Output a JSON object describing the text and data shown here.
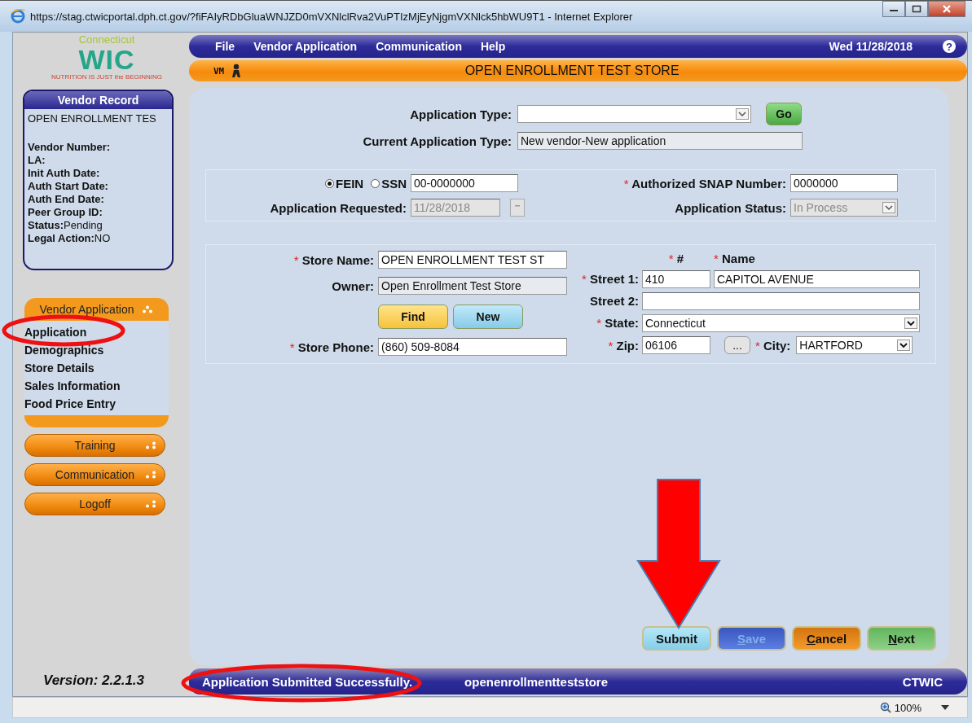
{
  "window": {
    "title": "https://stag.ctwicportal.dph.ct.gov/?fiFAIyRDbGluaWNJZD0mVXNlclRva2VuPTIzMjEyNjgmVXNlck5hbWU9T1 - Internet Explorer",
    "zoom": "100%"
  },
  "logo": {
    "state": "Connecticut",
    "mark": "WIC",
    "tagline": "NUTRITION IS JUST the BEGINNING"
  },
  "menu": [
    "File",
    "Vendor Application",
    "Communication",
    "Help"
  ],
  "date": "Wed 11/28/2018",
  "help": "?",
  "banner": {
    "code": "VM",
    "title": "OPEN ENROLLMENT TEST STORE"
  },
  "vendor_record": {
    "title": "Vendor Record",
    "name": "OPEN ENROLLMENT TES",
    "fields": [
      {
        "label": "Vendor Number:"
      },
      {
        "label": "LA:"
      },
      {
        "label": "Init Auth Date:"
      },
      {
        "label": "Auth Start Date:"
      },
      {
        "label": "Auth End Date:"
      },
      {
        "label": "Peer Group ID:"
      },
      {
        "label": "Status:",
        "value": "Pending"
      },
      {
        "label": "Legal Action:",
        "value": "NO"
      }
    ]
  },
  "nav": {
    "section": "Vendor Application",
    "items": [
      "Application",
      "Demographics",
      "Store Details",
      "Sales Information",
      "Food Price Entry"
    ],
    "menus": [
      "Training",
      "Communication",
      "Logoff"
    ]
  },
  "application_type": {
    "label": "Application Type:",
    "go": "Go",
    "current_label": "Current Application Type:",
    "current": "New vendor-New application"
  },
  "identity": {
    "id_types": [
      {
        "label": "FEIN",
        "selected": true
      },
      {
        "label": "SSN",
        "selected": false
      }
    ],
    "id_value": "00-0000000",
    "requested_label": "Application Requested:",
    "requested": "11/28/2018",
    "snap_label": {
      "text": "Authorized SNAP Number:",
      "mark": "*"
    },
    "snap": "0000000",
    "status_label": "Application Status:",
    "status": "In Process"
  },
  "store": {
    "name": {
      "label": "Store Name:",
      "mark": "*",
      "value": "OPEN ENROLLMENT TEST ST"
    },
    "owner": {
      "label": "Owner:",
      "value": "Open Enrollment Test Store"
    },
    "buttons": [
      "Find",
      "New"
    ],
    "phone": {
      "label": "Store Phone:",
      "mark": "*",
      "value": "(860) 509-8084"
    }
  },
  "address": {
    "number_header": {
      "text": "#",
      "mark": "*"
    },
    "name_header": {
      "text": "Name",
      "mark": "*"
    },
    "street1": {
      "label": "Street 1:",
      "mark": "*",
      "number": "410",
      "name": "CAPITOL AVENUE"
    },
    "street2": {
      "label": "Street 2:"
    },
    "state": {
      "label": "State:",
      "mark": "*",
      "value": "Connecticut"
    },
    "zip": {
      "label": "Zip:",
      "mark": "*",
      "value": "06106"
    },
    "lookup": "...",
    "city": {
      "label": "City:",
      "mark": "*",
      "value": "HARTFORD"
    }
  },
  "actions": [
    {
      "label": "Submit",
      "kind": "submit",
      "disabled": false,
      "access_key": false
    },
    {
      "label": "Save",
      "kind": "save",
      "disabled": true,
      "access_key": true
    },
    {
      "label": "Cancel",
      "kind": "cancel",
      "disabled": false,
      "access_key": true
    },
    {
      "label": "Next",
      "kind": "next",
      "disabled": false,
      "access_key": true
    }
  ],
  "footer": {
    "version": "Version: 2.2.1.3",
    "message": "Application Submitted Successfully.",
    "user": "openenrollmentteststore",
    "app": "CTWIC"
  }
}
